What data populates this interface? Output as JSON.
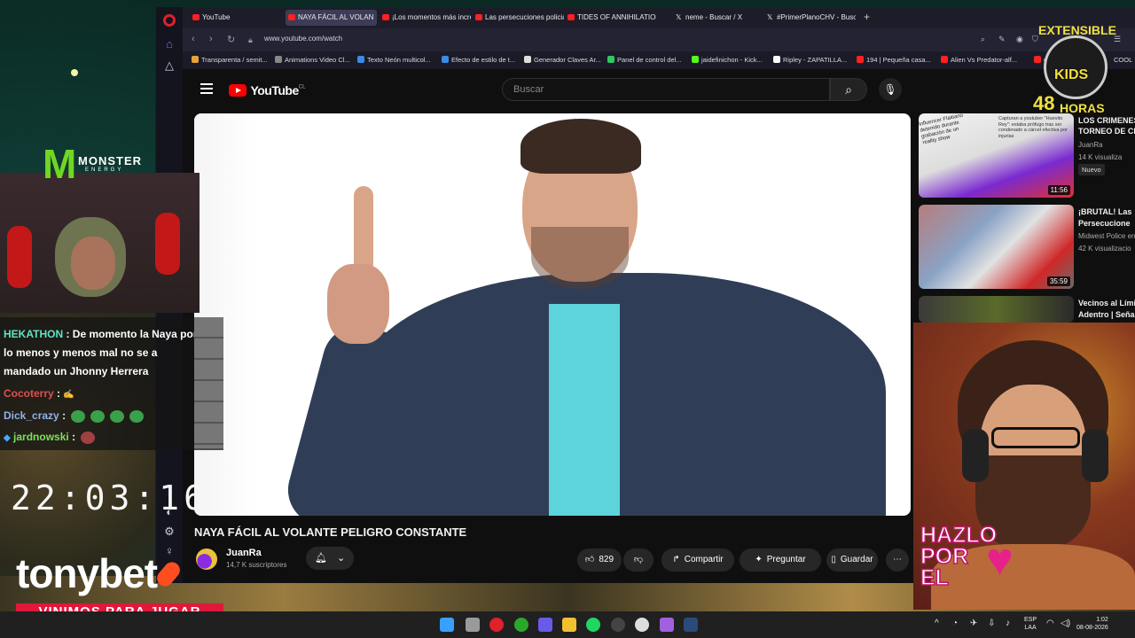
{
  "browser": {
    "tabs": [
      {
        "label": "YouTube",
        "icon": "youtube-icon"
      },
      {
        "label": "NAYA FÁCIL AL VOLAN",
        "icon": "youtube-icon",
        "active": true
      },
      {
        "label": "¡Los momentos más incre",
        "icon": "youtube-icon"
      },
      {
        "label": "Las persecuciones policial",
        "icon": "youtube-icon"
      },
      {
        "label": "TIDES OF ANNIHILATION",
        "icon": "youtube-icon"
      },
      {
        "label": "neme - Buscar / X",
        "icon": "x-icon"
      },
      {
        "label": "#PrimerPlanoCHV - Busca",
        "icon": "x-icon"
      }
    ],
    "url": "www.youtube.com/watch",
    "bookmarks": [
      "Transparenta / semit...",
      "Animations Video Cl...",
      "Texto Neón multicol...",
      "Efecto de estilo de t...",
      "Generador Claves Ar...",
      "Panel de control del...",
      "jaidefinichon - Kick...",
      "Ripley - ZAPATILLA...",
      "194 | Pequeña casa...",
      "Alien Vs Predator-alf...",
      "cre",
      "COOL"
    ]
  },
  "youtube": {
    "logo_text": "YouTube",
    "country": "CL",
    "search_placeholder": "Buscar",
    "video_title": "NAYA FÁCIL AL VOLANTE PELIGRO CONSTANTE",
    "channel_name": "JuanRa",
    "subscribers": "14,7 K suscriptores",
    "likes": "829",
    "share_label": "Compartir",
    "ask_label": "Preguntar",
    "save_label": "Guardar",
    "recommendations": [
      {
        "title": "LOS CRIMENES",
        "title2": "TORNEO DE CE",
        "channel": "JuanRa",
        "views": "14 K visualiza",
        "badge": "Nuevo",
        "duration": "11:56",
        "thumb_caption": "Capturan a youtuber \"Huevito Rey\": estaba prófugo tras ser condenado a cárcel efectiva por injurias",
        "thumb_caption2": "Influencer Flaitiano detenido durante grabación de un reality show"
      },
      {
        "title": "¡BRUTAL! Las",
        "title2": "Persecucione",
        "channel": "Midwest Police en",
        "views": "42 K visualizacio",
        "duration": "35:59"
      },
      {
        "title": "Vecinos al Límit",
        "title2": "Adentro | Seña"
      }
    ]
  },
  "overlays": {
    "brand": "MONSTER",
    "brand_sub": "ENERGY",
    "chat": [
      {
        "user": "HEKATHON",
        "color": "#5fe3c0",
        "text": "De momento la Naya por",
        "text2": "lo menos y menos mal no se a",
        "text3": "mandado un Jhonny Herrera"
      },
      {
        "user": "Cocoterry",
        "color": "#e05050",
        "text": ":"
      },
      {
        "user": "Dick_crazy",
        "color": "#8fb3e8",
        "text": ":"
      },
      {
        "user": "jardnowski",
        "color": "#7be05a",
        "text": ":"
      }
    ],
    "clock": "22:03:16",
    "sponsor": "tonybet",
    "slogan": "VINIMOS PARA JUGAR",
    "event_top": "EXTENSIBLE",
    "event_kids": "KIDS",
    "event_hours_num": "48",
    "event_hours": "HORAS",
    "hazlo_1": "HAZLO",
    "hazlo_2": "POR",
    "hazlo_3": "EL"
  },
  "taskbar": {
    "lang_1": "ESP",
    "lang_2": "LAA",
    "time": "1:02",
    "date": "08-08-2026"
  },
  "colors": {
    "youtube_red": "#ff0000",
    "monster_green": "#71d624",
    "slogan_red": "#e0183a",
    "accent_purple": "#6f6cff"
  }
}
